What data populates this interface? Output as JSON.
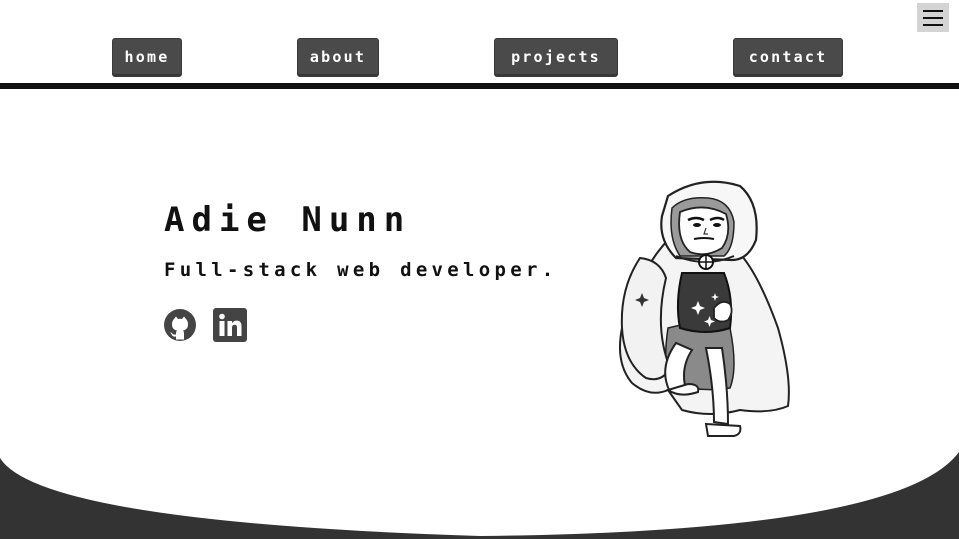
{
  "nav": {
    "items": [
      {
        "label": "home"
      },
      {
        "label": "about"
      },
      {
        "label": "projects"
      },
      {
        "label": "contact"
      }
    ],
    "menu_icon": "hamburger-menu-icon"
  },
  "hero": {
    "name": "Adie Nunn",
    "tagline": "Full-stack web developer."
  },
  "social": {
    "github_icon": "github-icon",
    "linkedin_icon": "linkedin-icon"
  },
  "colors": {
    "button_bg": "#4a4a4a",
    "text": "#111111",
    "divider": "#111111",
    "footer": "#333333",
    "menu_bg": "#d4d4d4"
  }
}
